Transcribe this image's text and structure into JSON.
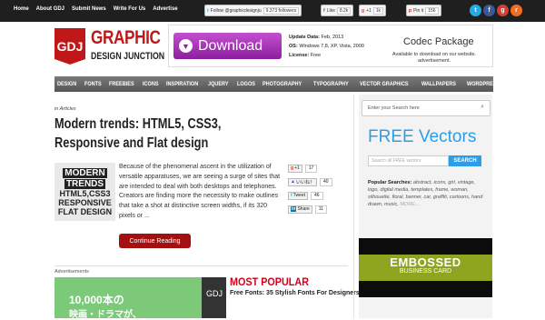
{
  "topnav": [
    "Home",
    "About GDJ",
    "Submit News",
    "Write For Us",
    "Advertise"
  ],
  "social_counters": {
    "twitter_label": "Follow @graphicdesignju",
    "twitter_count": "9,373 followers",
    "like_label": "Like",
    "like_count": "8.2k",
    "plus_label": "+1",
    "plus_count": "1k",
    "pin_label": "Pin it",
    "pin_count": "156"
  },
  "social_icons": [
    {
      "name": "twitter-icon",
      "glyph": "t",
      "color": "#2aa9e0"
    },
    {
      "name": "facebook-icon",
      "glyph": "f",
      "color": "#3b5998"
    },
    {
      "name": "googleplus-icon",
      "glyph": "g",
      "color": "#d23f2e"
    },
    {
      "name": "rss-icon",
      "glyph": "r",
      "color": "#f26c22"
    }
  ],
  "logo": {
    "badge": "GDJ",
    "line1": "GRAPHIC",
    "line2": "DESIGN JUNCTION"
  },
  "ad": {
    "button": "Download",
    "update_label": "Update Data:",
    "update_value": "Feb, 2013",
    "os_label": "OS:",
    "os_value": "Windows 7,8, XP, Vista, 2000",
    "license_label": "License:",
    "license_value": "Free",
    "product": "Codec Package",
    "product_sub": "Available to download on our website. advertisement."
  },
  "menu": [
    "DESIGN",
    "FONTS",
    "FREEBIES",
    "ICONS",
    "INSPIRATION",
    "JQUERY",
    "LOGOS",
    "PHOTOGRAPHY",
    "TYPOGRAPHY",
    "VECTOR GRAPHICS",
    "WALLPAPERS",
    "WORDPRESS THEMES"
  ],
  "article": {
    "crumb": "in Articles",
    "title": "Modern trends: HTML5, CSS3, Responsive and Flat design",
    "thumb_line1": "MODERN",
    "thumb_line2": "TRENDS",
    "thumb_line3": "HTML5,CSS3",
    "thumb_line4": "RESPONSIVE",
    "thumb_line5": "FLAT DESIGN",
    "excerpt": "Because of the phenomenal ascent in the utilization of versatile apparatuses, we are seeing a surge of sites that are intended to deal with both desktops and telephones. Creators are finding more the necessity to make outlines that take a shot at distinctive screen widths, if its 320 pixels or ...",
    "continue": "Continue Reading"
  },
  "share": {
    "gplus_label": "+1",
    "gplus_count": "17",
    "like_label": "いいね！",
    "like_count": "40",
    "tweet_label": "Tweet",
    "tweet_count": "46",
    "linkedin_label": "Share",
    "linkedin_count": "11"
  },
  "ads_label": "Advertisements",
  "promo": {
    "line1": "10,000本の",
    "line2": "映画・ドラマが、"
  },
  "most_popular": {
    "title": "MOST POPULAR",
    "item": "Free Fonts: 35 Stylish Fonts For Designers",
    "thumb_text": "GDJ"
  },
  "sidebar": {
    "search_placeholder": "Enter your Search here",
    "freevectors_a": "FREE ",
    "freevectors_b": "Vectors",
    "fv_placeholder": "Search all FREE vectors",
    "fv_button": "SEARCH",
    "popular_label": "Popular Searches:",
    "popular_terms": "abstract, icons, girl, vintage, logo, digital media, templates, frame, woman, silhouette, floral, banner, car, graffiti, cartoons, hand drawn, music,",
    "more": "MORE...",
    "emb_title": "EMBOSSED",
    "emb_sub": "BUSINESS CARD"
  }
}
